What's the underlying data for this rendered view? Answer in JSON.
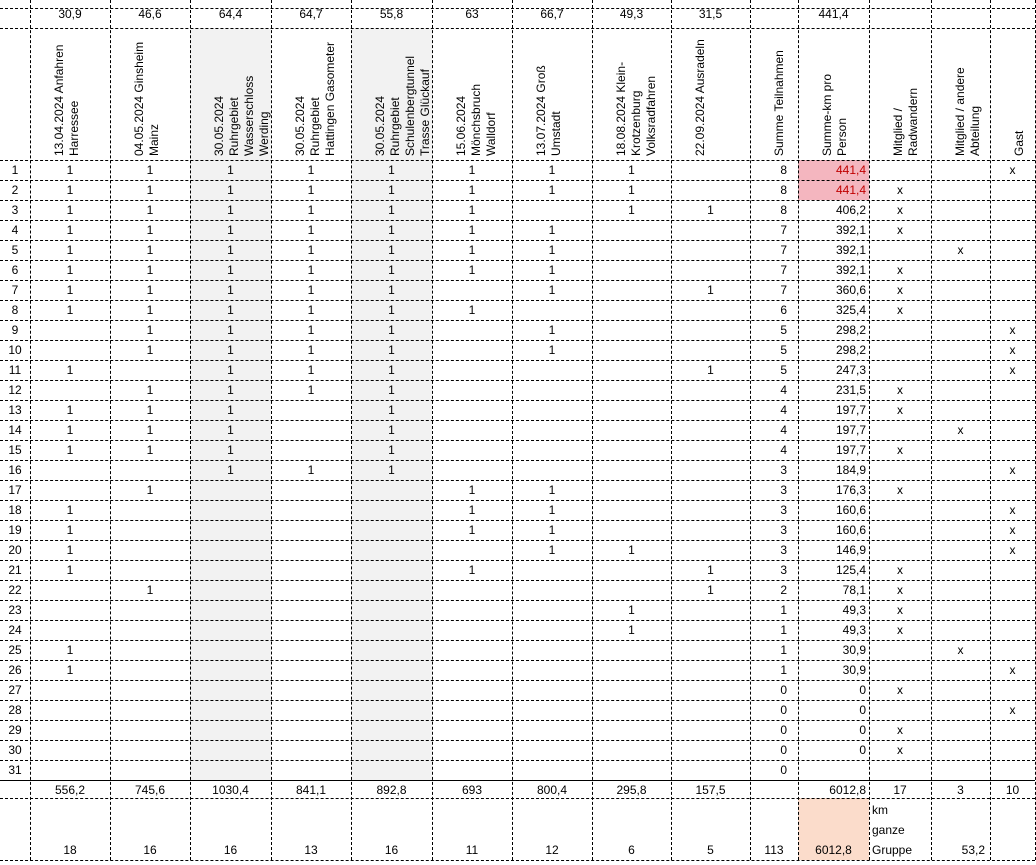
{
  "top_km": [
    "30,9",
    "46,6",
    "64,4",
    "64,7",
    "55,8",
    "63",
    "66,7",
    "49,3",
    "31,5",
    "",
    "441,4"
  ],
  "headers": [
    [
      "13.04.2024 Anfahren",
      "Harressee"
    ],
    [
      "04.05.2024 Ginsheim",
      "Mainz"
    ],
    [
      "30.05.2024",
      "Ruhrgebiet",
      "Wasserschloss",
      "Werding"
    ],
    [
      "30.05.2024",
      "Ruhrgebiet",
      "Hattingen Gasometer"
    ],
    [
      "30.05.2024",
      "Ruhrgebiet",
      "Schulenbergtunnel",
      "Trasse Glückauf"
    ],
    [
      "15.06.2024",
      "Mönchsbruch",
      "Walldorf"
    ],
    [
      "13.07.2024 Groß",
      "Umstadt"
    ],
    [
      "18.08.2024 Klein-",
      "Krotzenburg",
      "Volksradfahren"
    ],
    [
      "22.09.2024 Ausradeln"
    ],
    [
      "Summe Teilnahmen"
    ],
    [
      "Summe-km pro",
      "Person"
    ],
    [
      "Mitglied /",
      "Radwandern"
    ],
    [
      "Mitglied / andere",
      "Abteilung"
    ],
    [
      "Gast"
    ]
  ],
  "rows": [
    {
      "n": "1",
      "e": [
        "1",
        "1",
        "1",
        "1",
        "1",
        "1",
        "1",
        "1",
        ""
      ],
      "sum": "8",
      "km": "441,4",
      "m": "",
      "a": "",
      "g": "x"
    },
    {
      "n": "2",
      "e": [
        "1",
        "1",
        "1",
        "1",
        "1",
        "1",
        "1",
        "1",
        ""
      ],
      "sum": "8",
      "km": "441,4",
      "m": "x",
      "a": "",
      "g": ""
    },
    {
      "n": "3",
      "e": [
        "1",
        "1",
        "1",
        "1",
        "1",
        "1",
        "",
        "1",
        "1"
      ],
      "sum": "8",
      "km": "406,2",
      "m": "x",
      "a": "",
      "g": ""
    },
    {
      "n": "4",
      "e": [
        "1",
        "1",
        "1",
        "1",
        "1",
        "1",
        "1",
        "",
        ""
      ],
      "sum": "7",
      "km": "392,1",
      "m": "x",
      "a": "",
      "g": ""
    },
    {
      "n": "5",
      "e": [
        "1",
        "1",
        "1",
        "1",
        "1",
        "1",
        "1",
        "",
        ""
      ],
      "sum": "7",
      "km": "392,1",
      "m": "",
      "a": "x",
      "g": ""
    },
    {
      "n": "6",
      "e": [
        "1",
        "1",
        "1",
        "1",
        "1",
        "1",
        "1",
        "",
        ""
      ],
      "sum": "7",
      "km": "392,1",
      "m": "x",
      "a": "",
      "g": ""
    },
    {
      "n": "7",
      "e": [
        "1",
        "1",
        "1",
        "1",
        "1",
        "",
        "1",
        "",
        "1"
      ],
      "sum": "7",
      "km": "360,6",
      "m": "x",
      "a": "",
      "g": ""
    },
    {
      "n": "8",
      "e": [
        "1",
        "1",
        "1",
        "1",
        "1",
        "1",
        "",
        "",
        ""
      ],
      "sum": "6",
      "km": "325,4",
      "m": "x",
      "a": "",
      "g": ""
    },
    {
      "n": "9",
      "e": [
        "",
        "1",
        "1",
        "1",
        "1",
        "",
        "1",
        "",
        ""
      ],
      "sum": "5",
      "km": "298,2",
      "m": "",
      "a": "",
      "g": "x"
    },
    {
      "n": "10",
      "e": [
        "",
        "1",
        "1",
        "1",
        "1",
        "",
        "1",
        "",
        ""
      ],
      "sum": "5",
      "km": "298,2",
      "m": "",
      "a": "",
      "g": "x"
    },
    {
      "n": "11",
      "e": [
        "1",
        "",
        "1",
        "1",
        "1",
        "",
        "",
        "",
        "1"
      ],
      "sum": "5",
      "km": "247,3",
      "m": "",
      "a": "",
      "g": "x"
    },
    {
      "n": "12",
      "e": [
        "",
        "1",
        "1",
        "1",
        "1",
        "",
        "",
        "",
        ""
      ],
      "sum": "4",
      "km": "231,5",
      "m": "x",
      "a": "",
      "g": ""
    },
    {
      "n": "13",
      "e": [
        "1",
        "1",
        "1",
        "",
        "1",
        "",
        "",
        "",
        ""
      ],
      "sum": "4",
      "km": "197,7",
      "m": "x",
      "a": "",
      "g": ""
    },
    {
      "n": "14",
      "e": [
        "1",
        "1",
        "1",
        "",
        "1",
        "",
        "",
        "",
        ""
      ],
      "sum": "4",
      "km": "197,7",
      "m": "",
      "a": "x",
      "g": ""
    },
    {
      "n": "15",
      "e": [
        "1",
        "1",
        "1",
        "",
        "1",
        "",
        "",
        "",
        ""
      ],
      "sum": "4",
      "km": "197,7",
      "m": "x",
      "a": "",
      "g": ""
    },
    {
      "n": "16",
      "e": [
        "",
        "",
        "1",
        "1",
        "1",
        "",
        "",
        "",
        ""
      ],
      "sum": "3",
      "km": "184,9",
      "m": "",
      "a": "",
      "g": "x"
    },
    {
      "n": "17",
      "e": [
        "",
        "1",
        "",
        "",
        "",
        "1",
        "1",
        "",
        ""
      ],
      "sum": "3",
      "km": "176,3",
      "m": "x",
      "a": "",
      "g": ""
    },
    {
      "n": "18",
      "e": [
        "1",
        "",
        "",
        "",
        "",
        "1",
        "1",
        "",
        ""
      ],
      "sum": "3",
      "km": "160,6",
      "m": "",
      "a": "",
      "g": "x"
    },
    {
      "n": "19",
      "e": [
        "1",
        "",
        "",
        "",
        "",
        "1",
        "1",
        "",
        ""
      ],
      "sum": "3",
      "km": "160,6",
      "m": "",
      "a": "",
      "g": "x"
    },
    {
      "n": "20",
      "e": [
        "1",
        "",
        "",
        "",
        "",
        "",
        "1",
        "1",
        ""
      ],
      "sum": "3",
      "km": "146,9",
      "m": "",
      "a": "",
      "g": "x"
    },
    {
      "n": "21",
      "e": [
        "1",
        "",
        "",
        "",
        "",
        "1",
        "",
        "",
        "1"
      ],
      "sum": "3",
      "km": "125,4",
      "m": "x",
      "a": "",
      "g": ""
    },
    {
      "n": "22",
      "e": [
        "",
        "1",
        "",
        "",
        "",
        "",
        "",
        "",
        "1"
      ],
      "sum": "2",
      "km": "78,1",
      "m": "x",
      "a": "",
      "g": ""
    },
    {
      "n": "23",
      "e": [
        "",
        "",
        "",
        "",
        "",
        "",
        "",
        "1",
        ""
      ],
      "sum": "1",
      "km": "49,3",
      "m": "x",
      "a": "",
      "g": ""
    },
    {
      "n": "24",
      "e": [
        "",
        "",
        "",
        "",
        "",
        "",
        "",
        "1",
        ""
      ],
      "sum": "1",
      "km": "49,3",
      "m": "x",
      "a": "",
      "g": ""
    },
    {
      "n": "25",
      "e": [
        "1",
        "",
        "",
        "",
        "",
        "",
        "",
        "",
        ""
      ],
      "sum": "1",
      "km": "30,9",
      "m": "",
      "a": "x",
      "g": ""
    },
    {
      "n": "26",
      "e": [
        "1",
        "",
        "",
        "",
        "",
        "",
        "",
        "",
        ""
      ],
      "sum": "1",
      "km": "30,9",
      "m": "",
      "a": "",
      "g": "x"
    },
    {
      "n": "27",
      "e": [
        "",
        "",
        "",
        "",
        "",
        "",
        "",
        "",
        ""
      ],
      "sum": "0",
      "km": "0",
      "m": "x",
      "a": "",
      "g": ""
    },
    {
      "n": "28",
      "e": [
        "",
        "",
        "",
        "",
        "",
        "",
        "",
        "",
        ""
      ],
      "sum": "0",
      "km": "0",
      "m": "",
      "a": "",
      "g": "x"
    },
    {
      "n": "29",
      "e": [
        "",
        "",
        "",
        "",
        "",
        "",
        "",
        "",
        ""
      ],
      "sum": "0",
      "km": "0",
      "m": "x",
      "a": "",
      "g": ""
    },
    {
      "n": "30",
      "e": [
        "",
        "",
        "",
        "",
        "",
        "",
        "",
        "",
        ""
      ],
      "sum": "0",
      "km": "0",
      "m": "x",
      "a": "",
      "g": ""
    },
    {
      "n": "31",
      "e": [
        "",
        "",
        "",
        "",
        "",
        "",
        "",
        "",
        ""
      ],
      "sum": "0",
      "km": "",
      "m": "",
      "a": "",
      "g": ""
    }
  ],
  "totals_km": [
    "556,2",
    "745,6",
    "1030,4",
    "841,1",
    "892,8",
    "693",
    "800,4",
    "295,8",
    "157,5",
    "",
    "6012,8",
    "17",
    "3",
    "10"
  ],
  "counts": [
    "18",
    "16",
    "16",
    "13",
    "16",
    "11",
    "12",
    "6",
    "5",
    "113",
    "6012,8"
  ],
  "group_label": [
    "km",
    "ganze",
    "Gruppe"
  ],
  "avg": "53,2",
  "colors": {
    "shade": "#f2f2f2",
    "highlight_red": "#f4b6bf",
    "highlight_peach": "#fbdccb"
  }
}
